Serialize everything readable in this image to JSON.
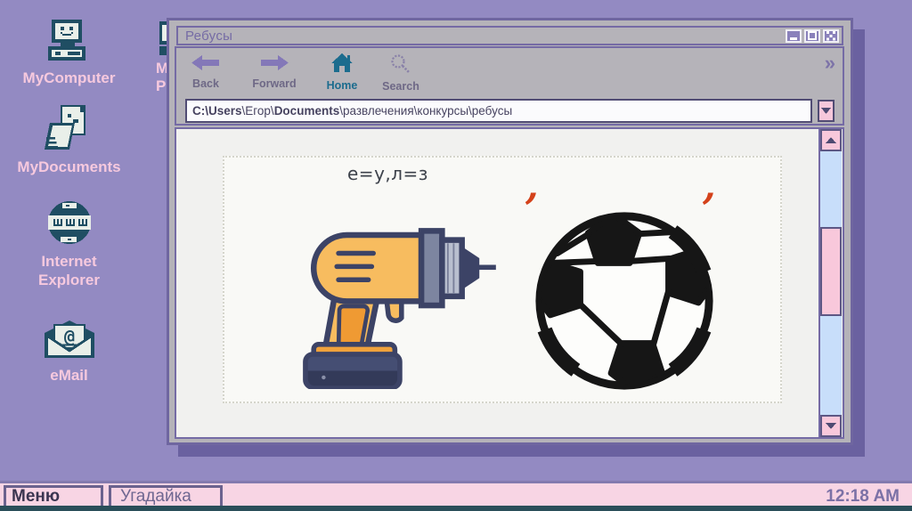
{
  "desktop": {
    "icons": [
      {
        "id": "my-computer",
        "label": "MyComputer"
      },
      {
        "id": "my-documents",
        "label": "MyDocuments"
      },
      {
        "id": "internet-explorer",
        "label": "Internet Explorer"
      },
      {
        "id": "email",
        "label": "eMail"
      }
    ],
    "partial_icon": {
      "line1": "M",
      "line2": "P"
    }
  },
  "window": {
    "title": "Ребусы",
    "toolbar": {
      "back": "Back",
      "forward": "Forward",
      "home": "Home",
      "search": "Search",
      "overflow": "»"
    },
    "address": {
      "seg1": "C:\\Users",
      "seg2": "\\Егор\\",
      "seg3": "Documents",
      "seg4": "\\развлечения\\конкурсы\\ребусы"
    }
  },
  "content": {
    "caption": "е=у,л=з",
    "comma": ","
  },
  "taskbar": {
    "menu": "Меню",
    "app": "Угадайка",
    "clock": "12:18 AM"
  },
  "colors": {
    "desktop": "#938ac2",
    "window_frame": "#b5b3b9",
    "accent_purple": "#756ba5",
    "pink": "#f8c8db",
    "icon_navy": "#1f4e63",
    "teal": "#1c6c8e",
    "comma_red": "#d4421b",
    "taskbar_pink": "#f8d5e4",
    "bottom_strip": "#2a4e59"
  }
}
